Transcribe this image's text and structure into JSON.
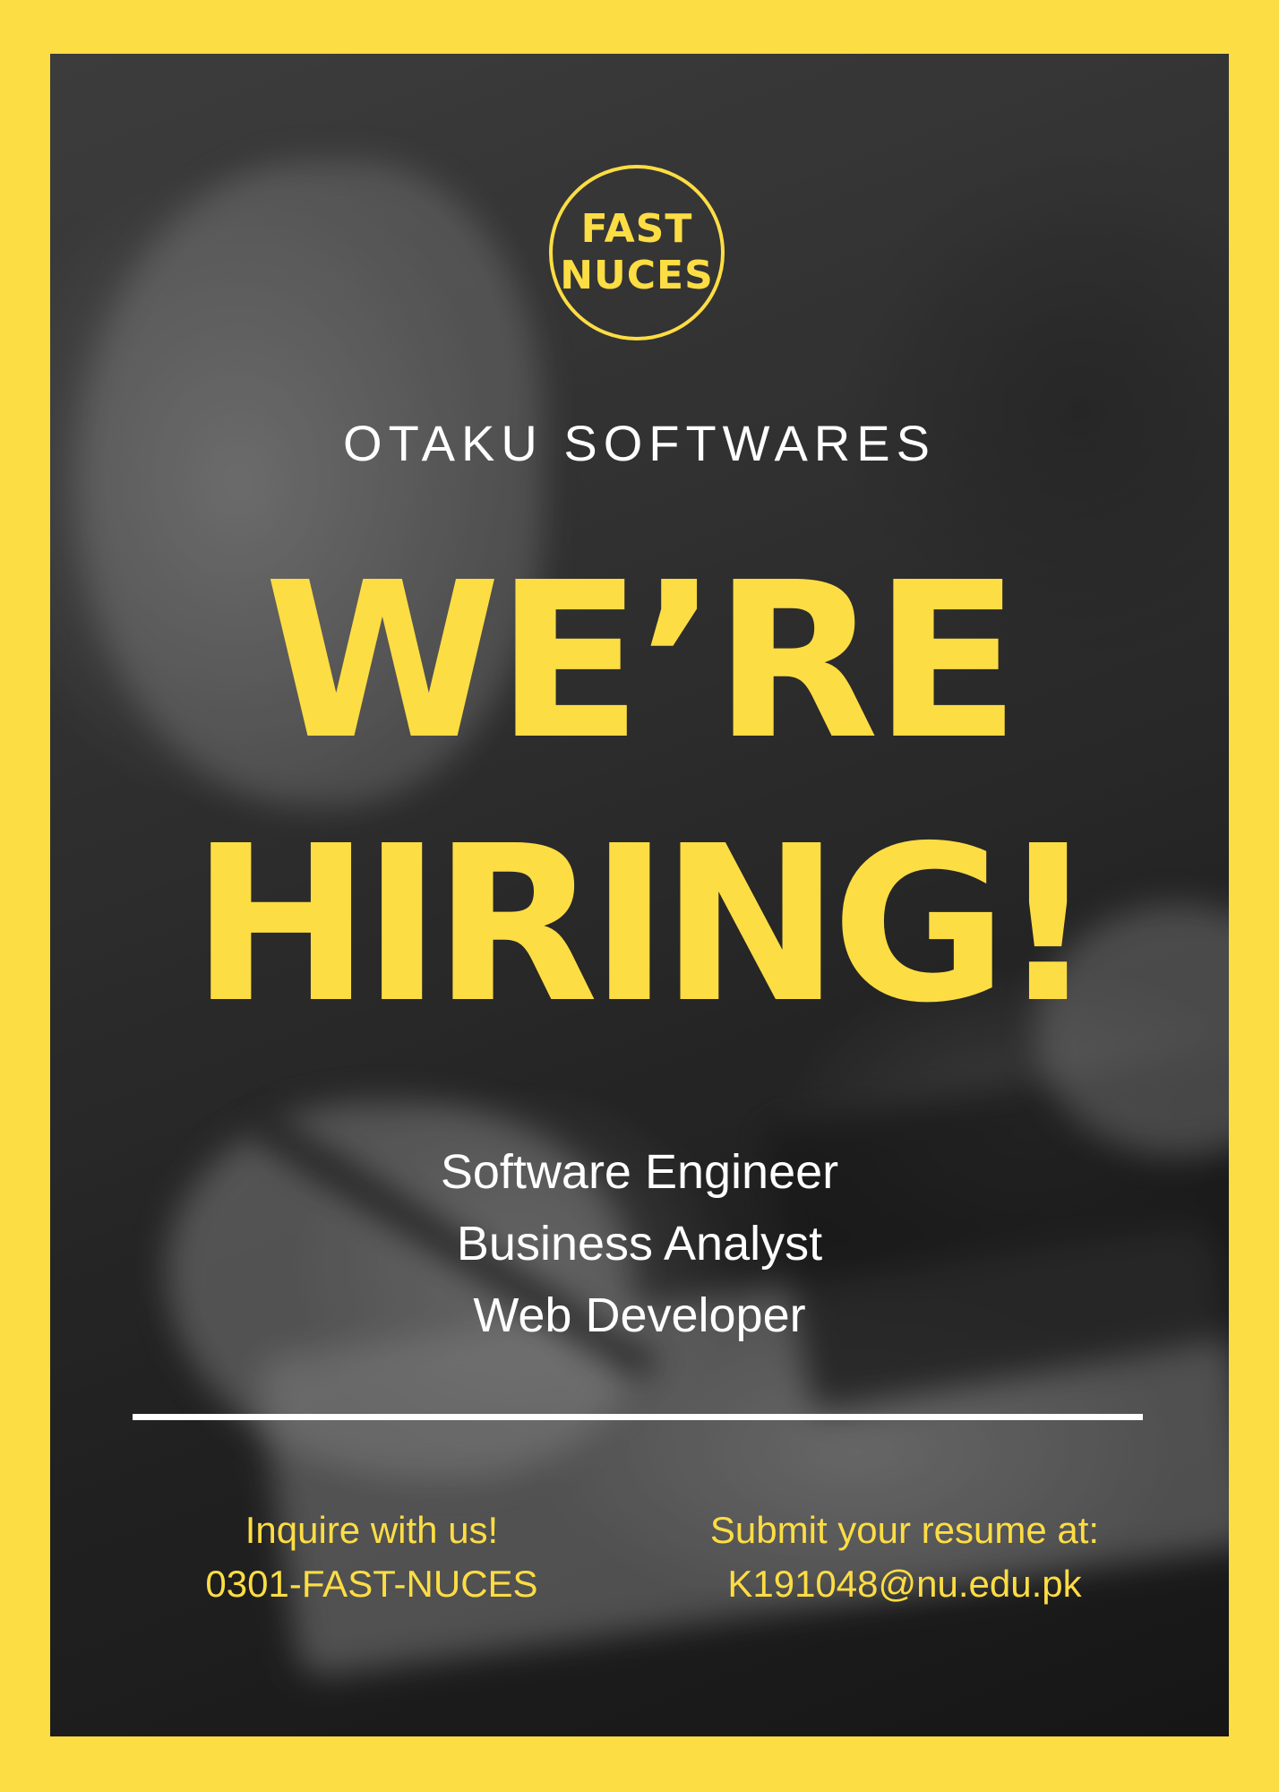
{
  "logo": {
    "line1": "FAST",
    "line2": "NUCES"
  },
  "company_name": "OTAKU SOFTWARES",
  "headline": {
    "line1": "WE’RE",
    "line2": "HIRING!"
  },
  "positions": [
    "Software Engineer",
    "Business Analyst",
    "Web Developer"
  ],
  "contact": {
    "inquire_label": "Inquire with us!",
    "phone": "0301-FAST-NUCES",
    "submit_label": "Submit your resume at:",
    "email": "K191048@nu.edu.pk"
  },
  "colors": {
    "accent": "#fddd44",
    "text": "#ffffff",
    "background": "#2b2b2b"
  }
}
